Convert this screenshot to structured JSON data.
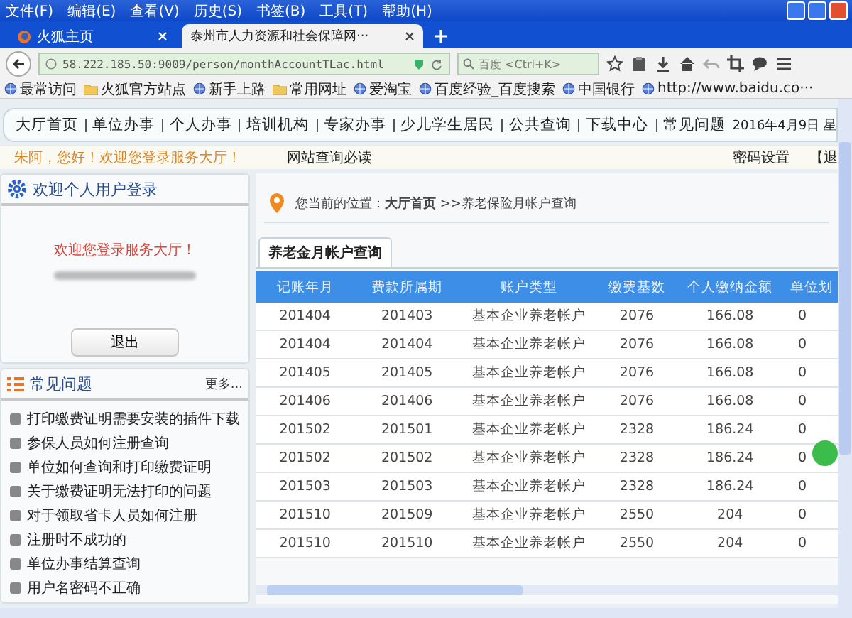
{
  "browser": {
    "menu": [
      "文件(F)",
      "编辑(E)",
      "查看(V)",
      "历史(S)",
      "书签(B)",
      "工具(T)",
      "帮助(H)"
    ],
    "tabs": [
      {
        "title": "火狐主页",
        "selected": false
      },
      {
        "title": "泰州市人力资源和社会保障网···",
        "selected": true
      }
    ],
    "address": "58.222.185.50:9009/person/monthAccountTLac.html",
    "search": {
      "placeholder": "百度 <Ctrl+K>"
    },
    "bookmarks": [
      {
        "label": "最常访问",
        "kind": "site"
      },
      {
        "label": "火狐官方站点",
        "kind": "folder"
      },
      {
        "label": "新手上路",
        "kind": "site"
      },
      {
        "label": "常用网址",
        "kind": "folder"
      },
      {
        "label": "爱淘宝",
        "kind": "site"
      },
      {
        "label": "百度经验_百度搜索",
        "kind": "site"
      },
      {
        "label": "中国银行",
        "kind": "site"
      },
      {
        "label": "http://www.baidu.co···",
        "kind": "site"
      }
    ]
  },
  "page": {
    "nav": [
      "大厅首页",
      "单位办事",
      "个人办事",
      "培训机构",
      "专家办事",
      "少儿学生居民",
      "公共查询",
      "下载中心",
      "常见问题"
    ],
    "date": "2016年4月9日 星",
    "welcome": "朱阿，您好！欢迎您登录服务大厅！",
    "notice": "网站查询必读",
    "links": [
      "密码设置",
      "【退"
    ],
    "login": {
      "title": "欢迎个人用户登录",
      "message": "欢迎您登录服务大厅！",
      "button": "退出"
    },
    "faq": {
      "title": "常见问题",
      "more": "更多...",
      "items": [
        "打印缴费证明需要安装的插件下载",
        "参保人员如何注册查询",
        "单位如何查询和打印缴费证明",
        "关于缴费证明无法打印的问题",
        "对于领取省卡人员如何注册",
        "注册时不成功的",
        "单位办事结算查询",
        "用户名密码不正确"
      ]
    },
    "breadcrumb": "您当前的位置：**大厅首页** >>养老保险月帐户查询",
    "tabs": [
      {
        "label": "养老金月帐户查询",
        "selected": true
      }
    ],
    "table": {
      "columns": [
        "记账年月",
        "费款所属期",
        "账户类型",
        "缴费基数",
        "个人缴纳金额",
        "单位划"
      ],
      "rows": [
        [
          "201404",
          "201403",
          "基本企业养老帐户",
          "2076",
          "166.08",
          "0"
        ],
        [
          "201404",
          "201404",
          "基本企业养老帐户",
          "2076",
          "166.08",
          "0"
        ],
        [
          "201405",
          "201405",
          "基本企业养老帐户",
          "2076",
          "166.08",
          "0"
        ],
        [
          "201406",
          "201406",
          "基本企业养老帐户",
          "2076",
          "166.08",
          "0"
        ],
        [
          "201502",
          "201501",
          "基本企业养老帐户",
          "2328",
          "186.24",
          "0"
        ],
        [
          "201502",
          "201502",
          "基本企业养老帐户",
          "2328",
          "186.24",
          "0"
        ],
        [
          "201503",
          "201503",
          "基本企业养老帐户",
          "2328",
          "186.24",
          "0"
        ],
        [
          "201510",
          "201509",
          "基本企业养老帐户",
          "2550",
          "204",
          "0"
        ],
        [
          "201510",
          "201510",
          "基本企业养老帐户",
          "2550",
          "204",
          "0"
        ]
      ]
    }
  }
}
